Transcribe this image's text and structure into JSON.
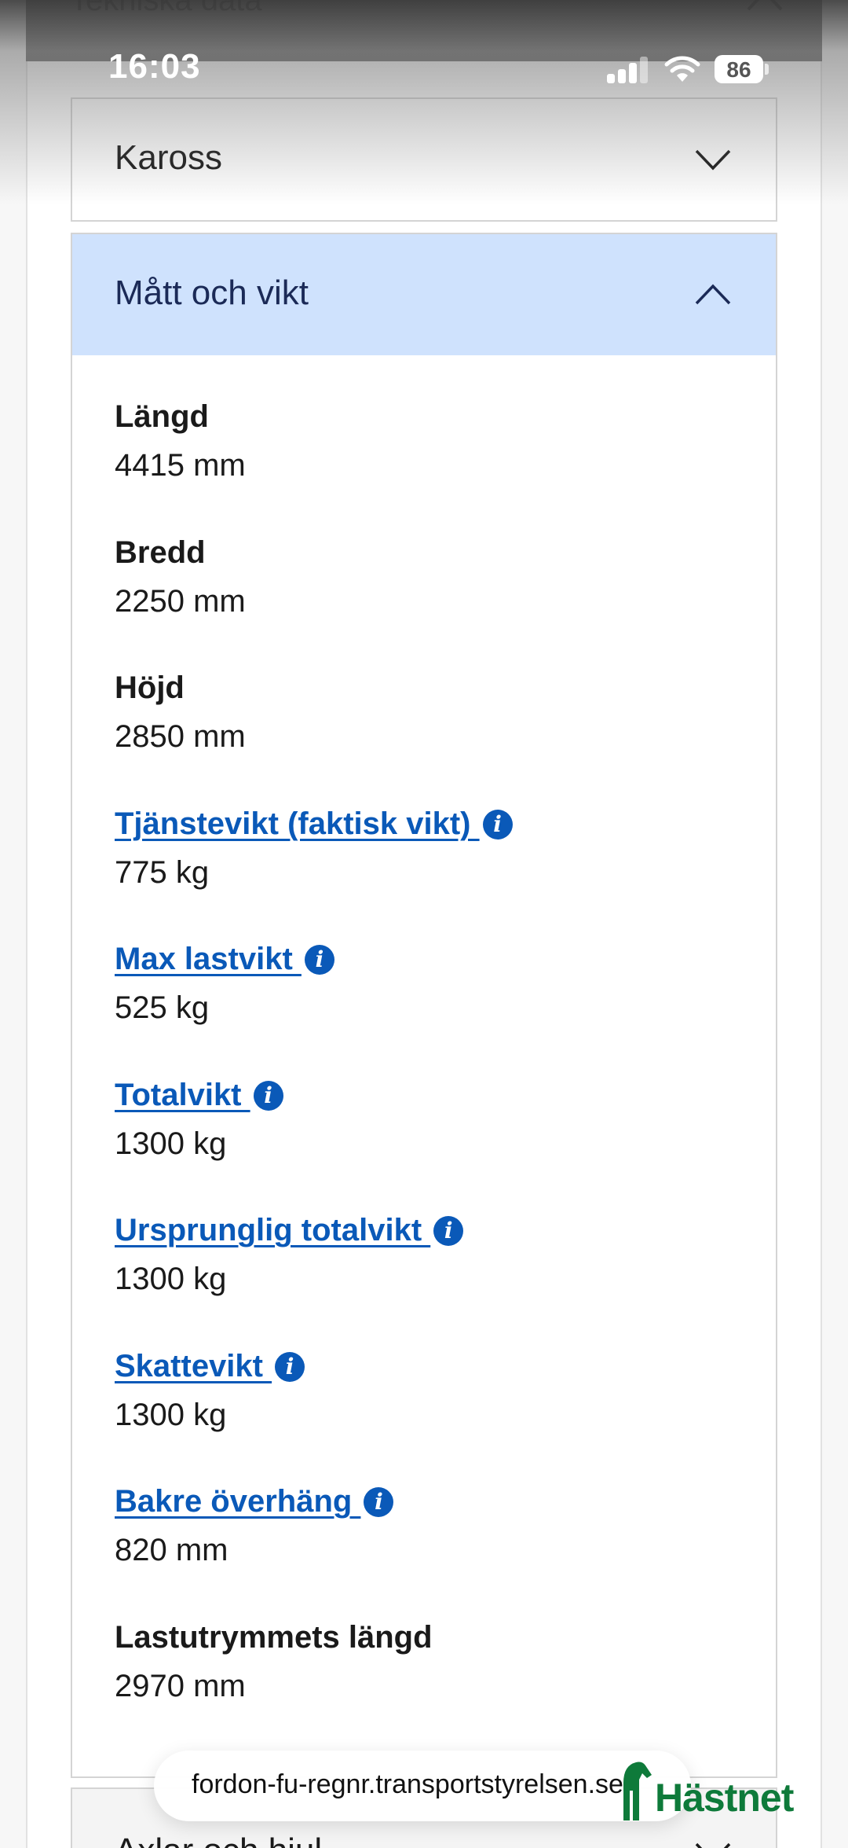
{
  "status_bar": {
    "time": "16:03",
    "battery_percent": "86",
    "signal_icon": "cellular-signal-icon",
    "wifi_icon": "wifi-icon"
  },
  "section": {
    "title": "Tekniska data"
  },
  "accordion": {
    "kaross": {
      "label": "Kaross",
      "expanded": false
    },
    "matt_och_vikt": {
      "label": "Mått och vikt",
      "expanded": true,
      "fields": [
        {
          "name": "Längd",
          "value": "4415 mm",
          "link": false
        },
        {
          "name": "Bredd",
          "value": "2250 mm",
          "link": false
        },
        {
          "name": "Höjd",
          "value": "2850 mm",
          "link": false
        },
        {
          "name": "Tjänstevikt (faktisk vikt) ",
          "value": "775 kg",
          "link": true
        },
        {
          "name": "Max lastvikt ",
          "value": "525 kg",
          "link": true
        },
        {
          "name": "Totalvikt ",
          "value": "1300 kg",
          "link": true
        },
        {
          "name": "Ursprunglig totalvikt ",
          "value": "1300 kg",
          "link": true
        },
        {
          "name": "Skattevikt ",
          "value": "1300 kg",
          "link": true
        },
        {
          "name": "Bakre överhäng ",
          "value": "820 mm",
          "link": true
        },
        {
          "name": "Lastutrymmets längd",
          "value": "2970 mm",
          "link": false
        }
      ]
    },
    "axlar_och_hjul": {
      "label": "Axlar och hjul",
      "expanded": false
    }
  },
  "info_icon_glyph": "i",
  "browser": {
    "url": "fordon-fu-regnr.transportstyrelsen.se"
  },
  "watermark": {
    "text": "Hästnet"
  },
  "colors": {
    "link": "#0a59b8",
    "expanded_header": "#cfe2fd",
    "expanded_header_text": "#1b2a57",
    "watermark": "#0e7a3a"
  }
}
